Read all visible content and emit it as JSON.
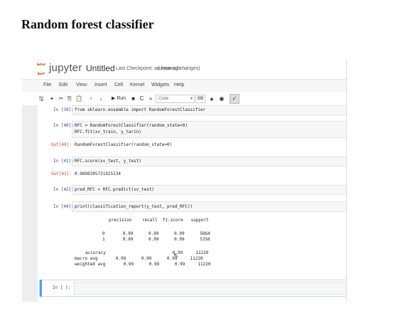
{
  "page_title": "Random forest classifier",
  "header": {
    "logo_text": "jupyter",
    "notebook_name": "Untitled",
    "checkpoint": "Last Checkpoint: an hour ago",
    "unsaved": "(unsaved changes)"
  },
  "menu": [
    "File",
    "Edit",
    "View",
    "Insert",
    "Cell",
    "Kernel",
    "Widgets",
    "Help"
  ],
  "toolbar": {
    "run_label": "▶ Run",
    "cell_type": "Code",
    "icons": [
      "save-icon",
      "plus-icon",
      "cut-icon",
      "copy-icon",
      "paste-icon",
      "arrow-up-icon",
      "arrow-down-icon",
      "run-icon",
      "stop-icon",
      "restart-icon",
      "fast-forward-icon",
      "keyboard-icon",
      "caret-up-icon",
      "eye-icon",
      "check-icon"
    ]
  },
  "cells": {
    "c39_prompt": "In [39]:",
    "c39_code": "from sklearn.ensemble import RandomForestClassifier",
    "c40_prompt": "In [40]:",
    "c40_line1": "RFC = RandomForestClassifier(random_state=0)",
    "c40_line2": "RFC.fit(xv_train, y_tarin)",
    "o40_prompt": "Out[40]:",
    "o40_text": "RandomForestClassifier(random_state=0)",
    "c41_prompt": "In [41]:",
    "c41_code": "RFC.score(xv_test, y_test)",
    "o41_prompt": "Out[41]:",
    "o41_text": "0.9898395721925134",
    "c42_prompt": "In [42]:",
    "c42_code": "pred_RFC = RFC.predict(xv_test)",
    "c44_prompt": "In [44]:",
    "c44_code": "print(classification_report(y_test, pred_RFC))",
    "report_header": "precision    recall  f1-score   support",
    "report_row0": "0       0.99      0.99      0.99      5864",
    "report_row1": "1       0.99      0.99      0.99      5356",
    "report_acc": "accuracy                          0.99     11220",
    "report_macro": "macro avg       0.99      0.99      0.99     11220",
    "report_weighted": "weighted avg       0.99      0.99      0.99     11220",
    "empty_prompt": "In [ ]:"
  }
}
